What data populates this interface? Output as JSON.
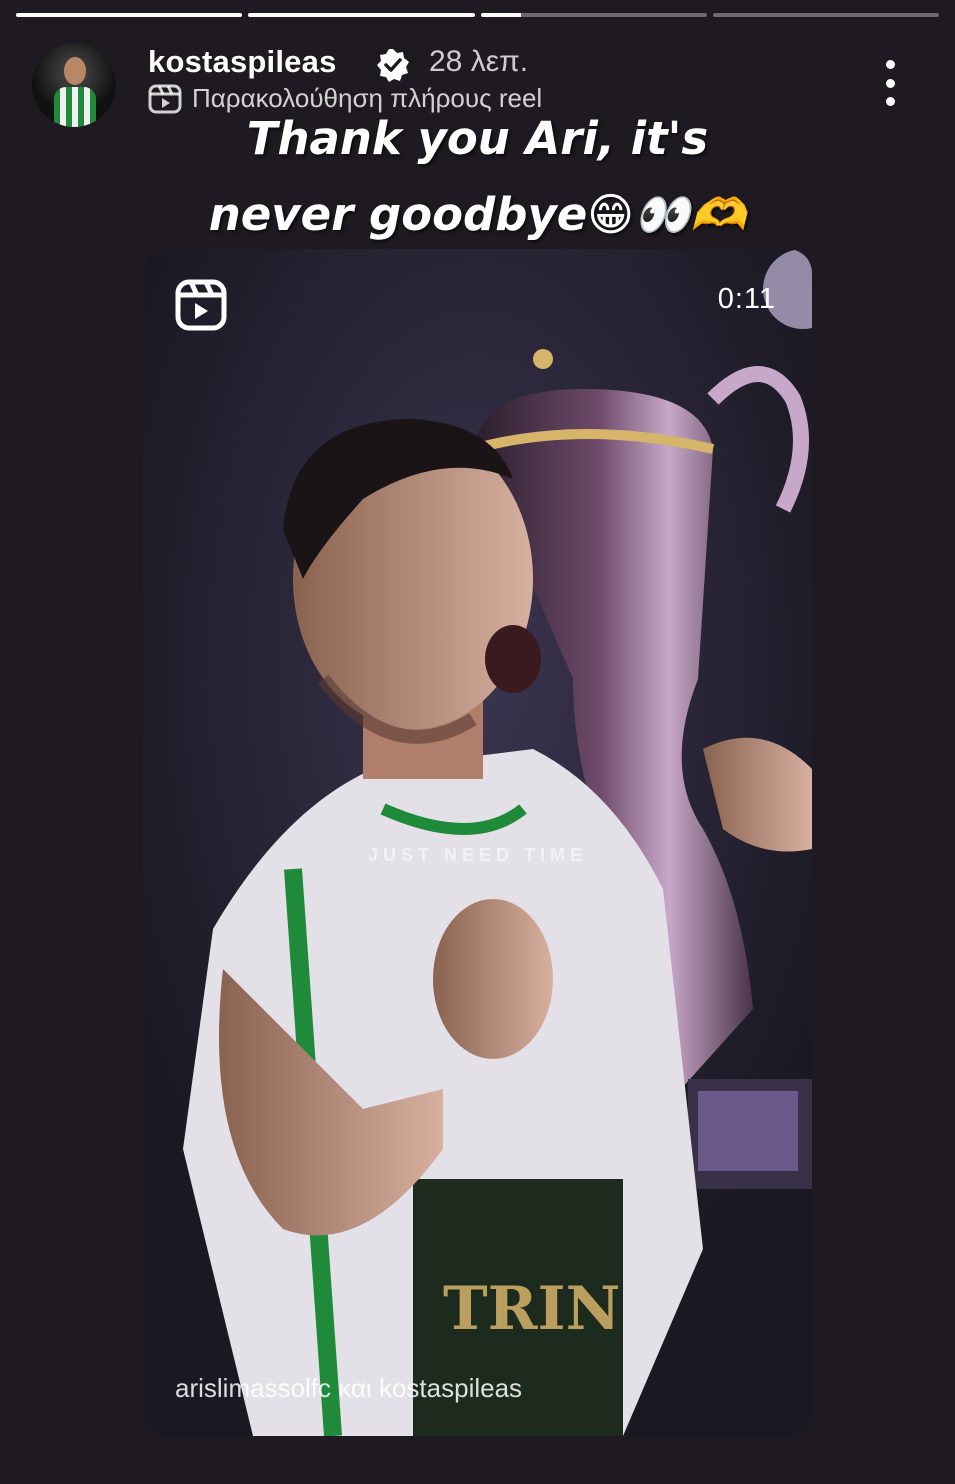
{
  "story": {
    "progress_segments": [
      1,
      1,
      0.18,
      0
    ],
    "username": "kostaspileas",
    "verified_icon": "verified-badge-icon",
    "time_ago": "28 λεπ.",
    "subtitle": "Παρακολούθηση πλήρους reel",
    "menu_icon": "more-vertical-icon",
    "caption_line1": "Thank you Ari, it's",
    "caption_line2": "never goodbye😁👀🫶"
  },
  "reel": {
    "icon": "reels-icon",
    "duration": "0:11",
    "overlay_text": "JUST NEED TIME",
    "credit": "arislimassolfc και kostaspileas"
  },
  "colors": {
    "background": "#1f1a22",
    "jersey_green": "#1f8a3a"
  }
}
